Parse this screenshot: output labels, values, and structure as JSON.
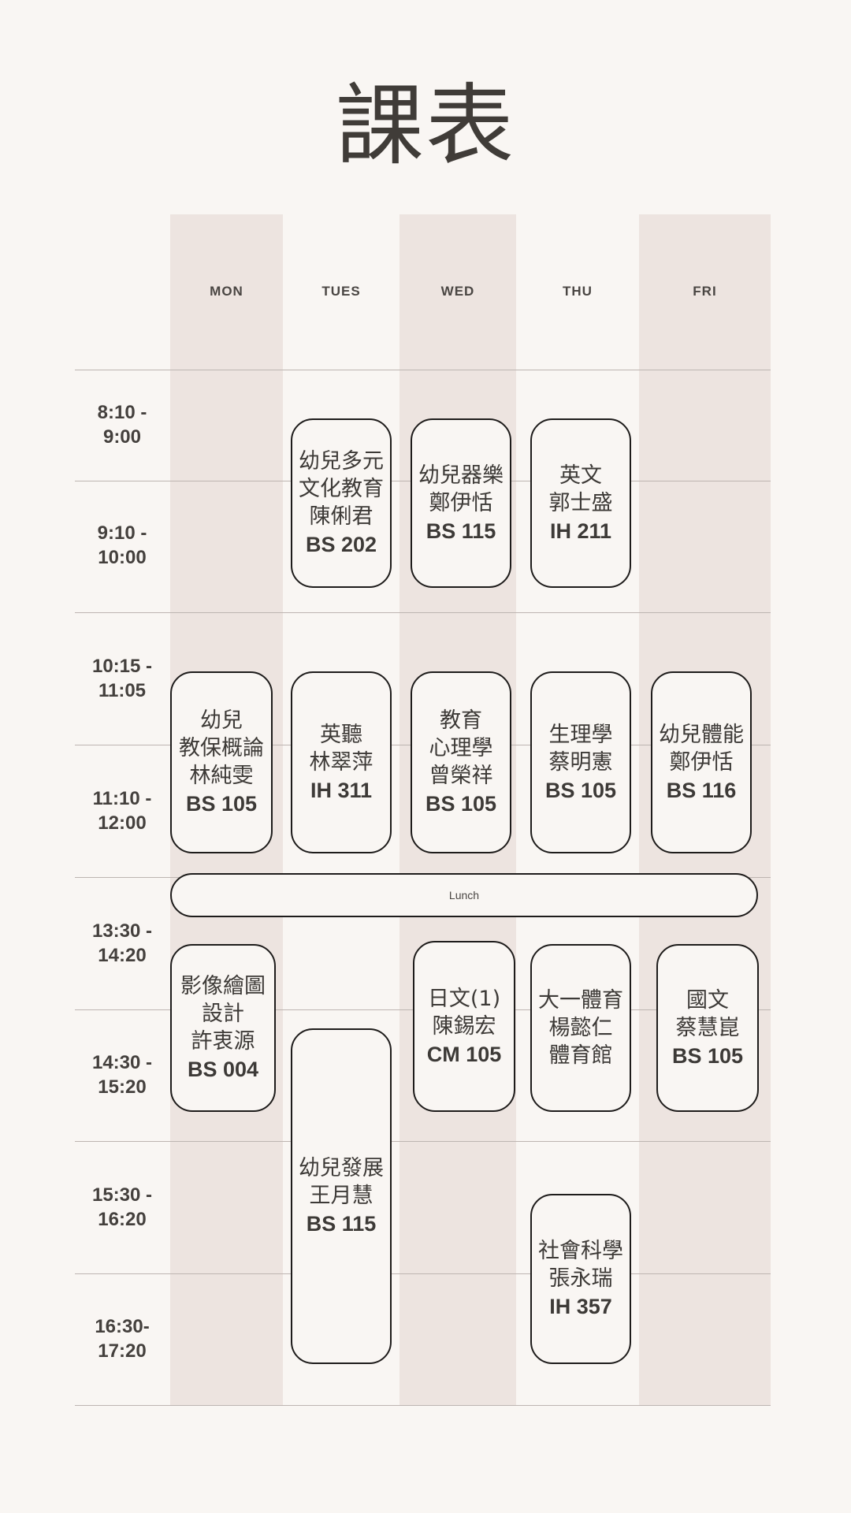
{
  "title": "課表",
  "days": [
    "MON",
    "TUES",
    "WED",
    "THU",
    "FRI"
  ],
  "times": [
    "8:10 -\n9:00",
    "9:10 -\n10:00",
    "10:15 -\n11:05",
    "11:10 -\n12:00",
    "13:30 -\n14:20",
    "14:30 -\n15:20",
    "15:30 -\n16:20",
    "16:30-\n17:20"
  ],
  "lunch": "Lunch",
  "courses": [
    {
      "day": "TUES",
      "slot": "8:10 - 10:00",
      "lines": [
        "幼兒多元",
        "文化教育",
        "陳俐君"
      ],
      "room": "BS 202"
    },
    {
      "day": "WED",
      "slot": "8:10 - 10:00",
      "lines": [
        "幼兒器樂",
        "鄭伊恬"
      ],
      "room": "BS 115"
    },
    {
      "day": "THU",
      "slot": "8:10 - 10:00",
      "lines": [
        "英文",
        "郭士盛"
      ],
      "room": "IH 211"
    },
    {
      "day": "MON",
      "slot": "10:15 - 12:00",
      "lines": [
        "幼兒",
        "教保概論",
        "林純雯"
      ],
      "room": "BS 105"
    },
    {
      "day": "TUES",
      "slot": "10:15 - 12:00",
      "lines": [
        "英聽",
        "林翠萍"
      ],
      "room": "IH 311"
    },
    {
      "day": "WED",
      "slot": "10:15 - 12:00",
      "lines": [
        "教育",
        "心理學",
        "曾榮祥"
      ],
      "room": "BS 105"
    },
    {
      "day": "THU",
      "slot": "10:15 - 12:00",
      "lines": [
        "生理學",
        "蔡明憲"
      ],
      "room": "BS 105"
    },
    {
      "day": "FRI",
      "slot": "10:15 - 12:00",
      "lines": [
        "幼兒體能",
        "鄭伊恬"
      ],
      "room": "BS 116"
    },
    {
      "day": "MON",
      "slot": "13:30 - 15:20",
      "lines": [
        "影像繪圖",
        "設計",
        "許衷源"
      ],
      "room": "BS 004"
    },
    {
      "day": "WED",
      "slot": "13:30 - 15:20",
      "lines": [
        "日文(1)",
        "陳錫宏"
      ],
      "room": "CM 105"
    },
    {
      "day": "THU",
      "slot": "13:30 - 15:20",
      "lines": [
        "大一體育",
        "楊懿仁",
        "體育館"
      ],
      "room": ""
    },
    {
      "day": "FRI",
      "slot": "13:30 - 15:20",
      "lines": [
        "國文",
        "蔡慧崑"
      ],
      "room": "BS 105"
    },
    {
      "day": "TUES",
      "slot": "14:30 - 17:20",
      "lines": [
        "幼兒發展",
        "王月慧"
      ],
      "room": "BS 115"
    },
    {
      "day": "THU",
      "slot": "15:30 - 17:20",
      "lines": [
        "社會科學",
        "張永瑞"
      ],
      "room": "IH 357"
    }
  ]
}
